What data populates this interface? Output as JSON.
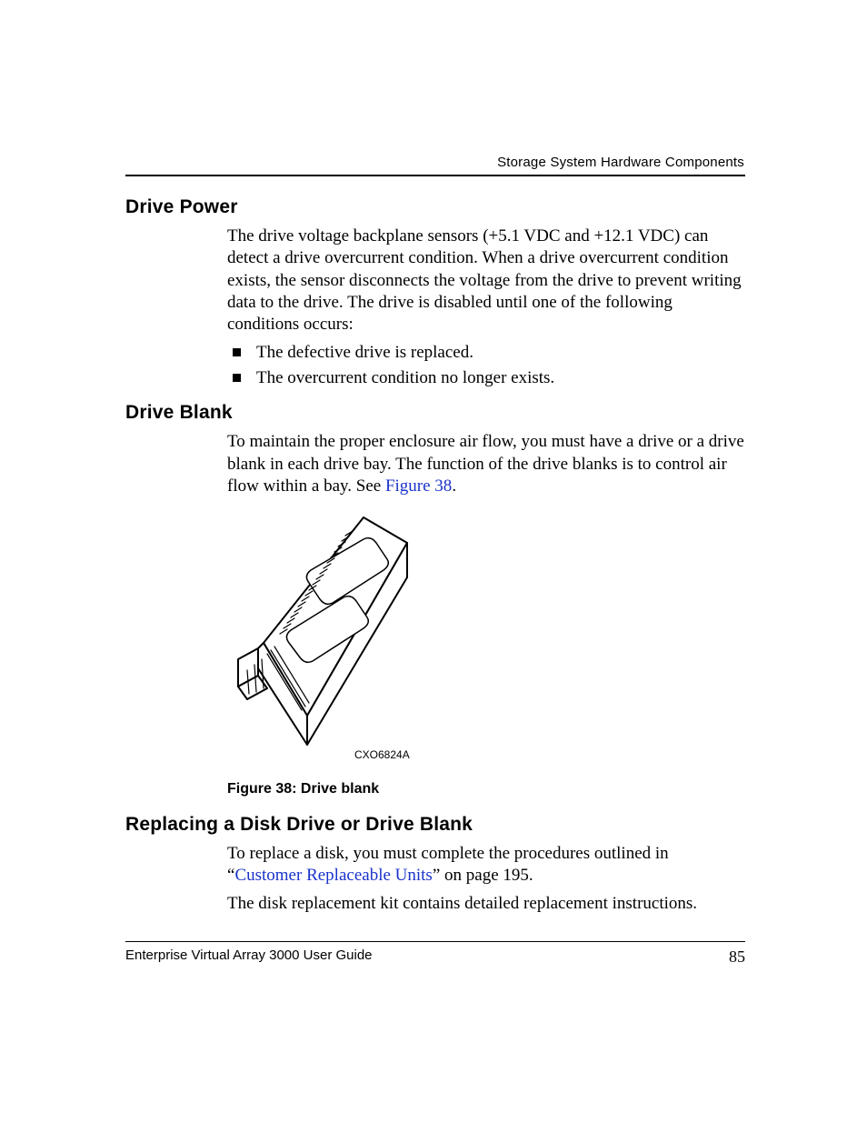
{
  "header": {
    "section": "Storage System Hardware Components"
  },
  "sections": {
    "drivePower": {
      "heading": "Drive Power",
      "para": "The drive voltage backplane sensors (+5.1 VDC and +12.1 VDC) can detect a drive overcurrent condition. When a drive overcurrent condition exists, the sensor disconnects the voltage from the drive to prevent writing data to the drive. The drive is disabled until one of the following conditions occurs:",
      "bullets": [
        "The defective drive is replaced.",
        "The overcurrent condition no longer exists."
      ]
    },
    "driveBlank": {
      "heading": "Drive Blank",
      "para_pre": "To maintain the proper enclosure air flow, you must have a drive or a drive blank in each drive bay. The function of the drive blanks is to control air flow within a bay. See ",
      "figref": "Figure 38",
      "para_post": ".",
      "figure_id": "CXO6824A",
      "figure_caption": "Figure 38:  Drive blank"
    },
    "replacing": {
      "heading": "Replacing a Disk Drive or Drive Blank",
      "para1_pre": "To replace a disk, you must complete the procedures outlined in “",
      "para1_link": "Customer Replaceable Units",
      "para1_post": "” on page 195.",
      "para2": "The disk replacement kit contains detailed replacement instructions."
    }
  },
  "footer": {
    "left": "Enterprise Virtual Array 3000 User Guide",
    "page": "85"
  }
}
